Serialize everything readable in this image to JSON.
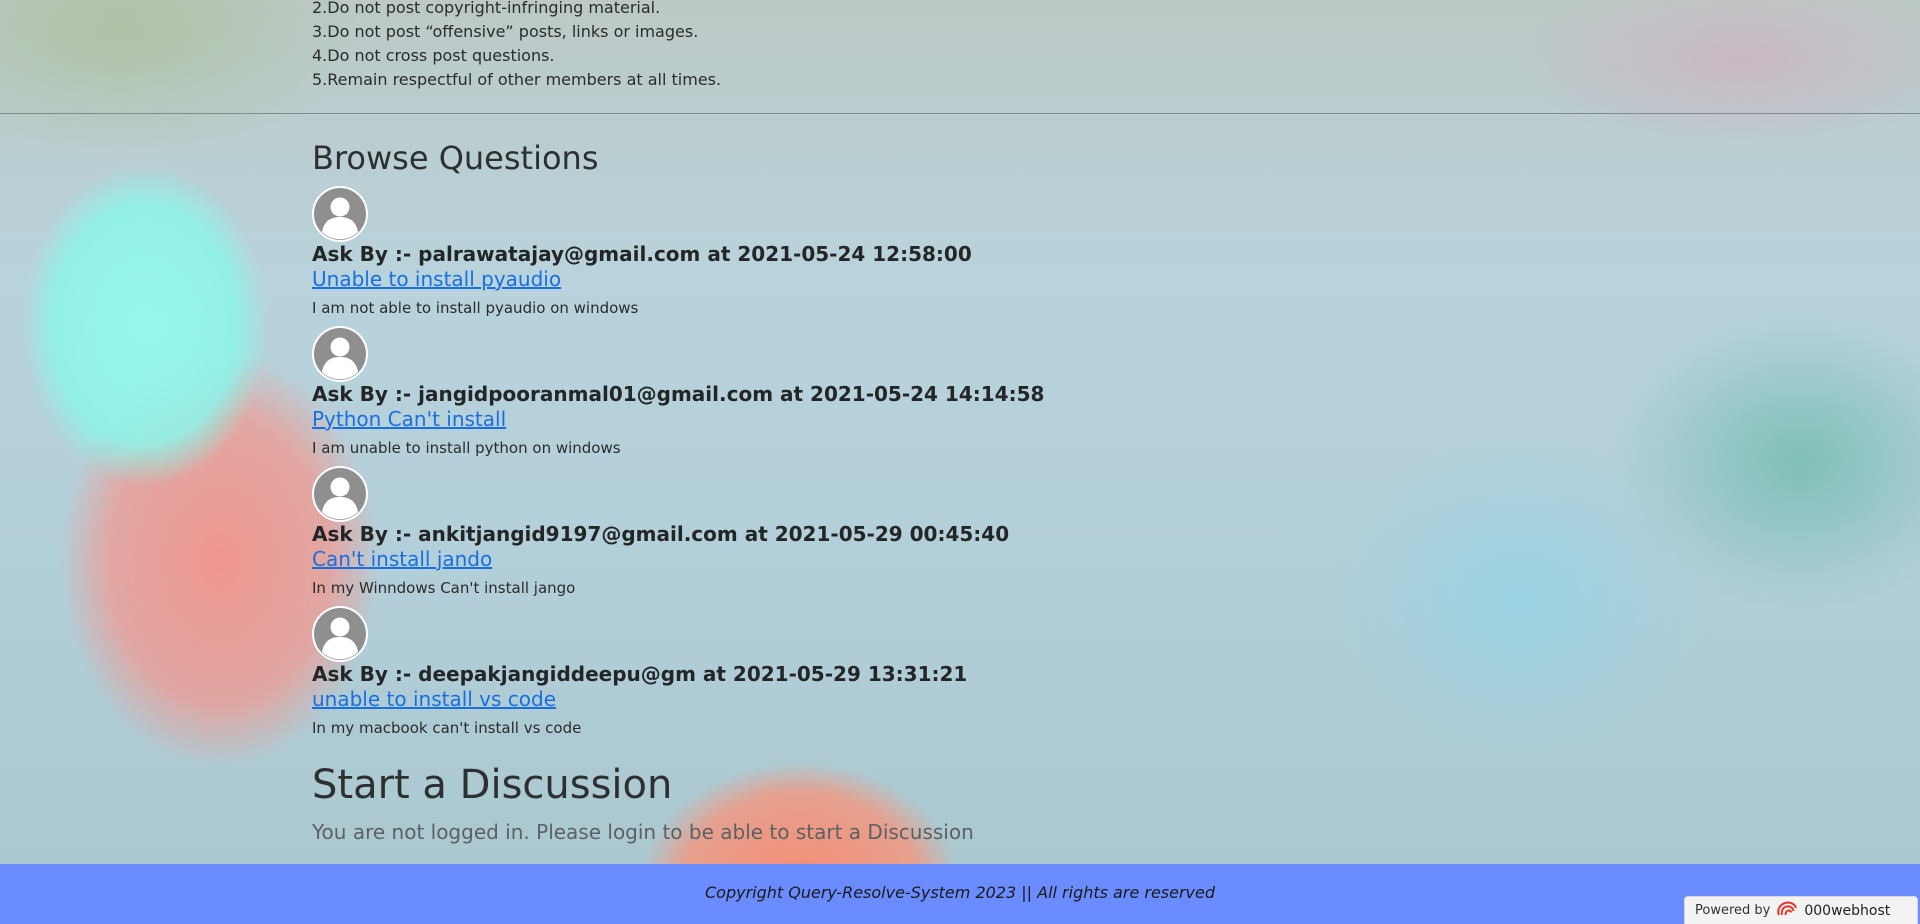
{
  "rules": [
    "2.Do not post copyright-infringing material.",
    "3.Do not post “offensive” posts, links or images.",
    "4.Do not cross post questions.",
    "5.Remain respectful of other members at all times."
  ],
  "browse": {
    "title": "Browse Questions",
    "questions": [
      {
        "asker": "Ask By :- palrawatajay@gmail.com at 2021-05-24 12:58:00",
        "title": "Unable to install pyaudio",
        "desc": "I am not able to install pyaudio on windows"
      },
      {
        "asker": "Ask By :- jangidpooranmal01@gmail.com at 2021-05-24 14:14:58",
        "title": "Python Can't install",
        "desc": "I am unable to install python on windows"
      },
      {
        "asker": "Ask By :- ankitjangid9197@gmail.com at 2021-05-29 00:45:40",
        "title": "Can't install jando",
        "desc": "In my Winndows Can't install jango"
      },
      {
        "asker": "Ask By :- deepakjangiddeepu@gm at 2021-05-29 13:31:21",
        "title": "unable to install vs code",
        "desc": "In my macbook can't install vs code"
      }
    ]
  },
  "discussion": {
    "title": "Start a Discussion",
    "message": "You are not logged in. Please login to be able to start a Discussion"
  },
  "footer": {
    "copyright": "Copyright Query-Resolve-System 2023 || All rights are reserved",
    "powered_label": "Powered by",
    "powered_brand": "000webhost"
  },
  "colors": {
    "link": "#1a6fe0",
    "footer_bg": "#6b8cff"
  }
}
